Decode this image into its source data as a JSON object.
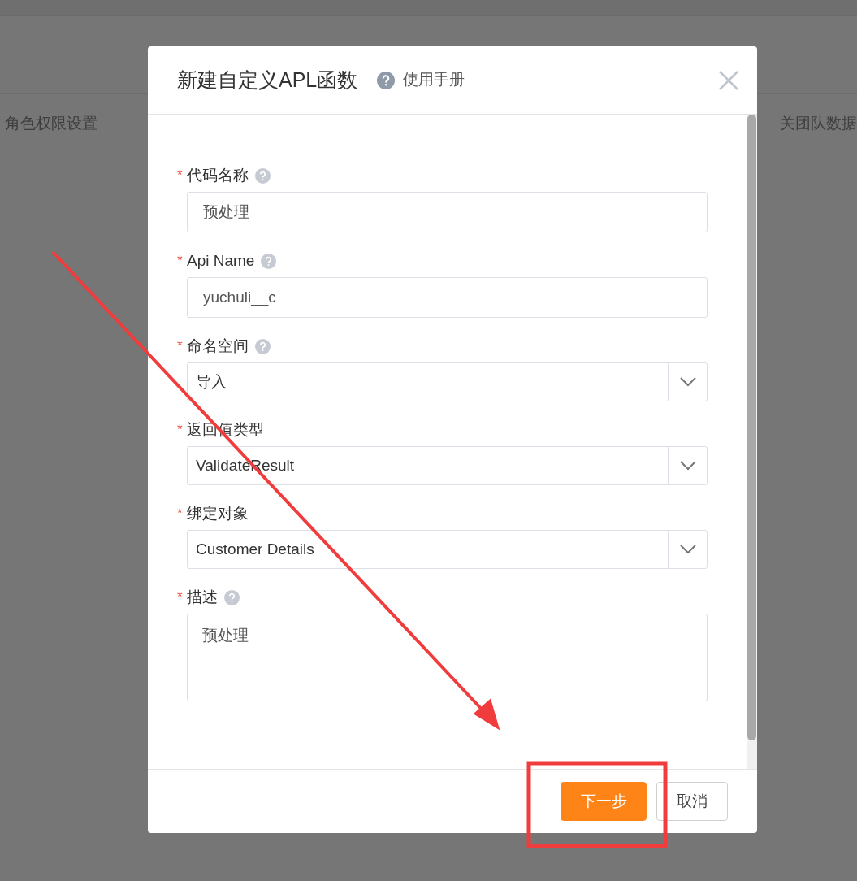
{
  "background_page": {
    "tabs": [
      {
        "label": "角色权限设置"
      },
      {
        "label": "关团队数据"
      }
    ]
  },
  "dialog": {
    "title": "新建自定义APL函数",
    "help_link": "使用手册",
    "fields": [
      {
        "kind": "text",
        "required_mark": "*",
        "label": "代码名称",
        "help": true,
        "value": "预处理"
      },
      {
        "kind": "text",
        "required_mark": "*",
        "label": "Api Name",
        "help": true,
        "value": "yuchuli__c"
      },
      {
        "kind": "select",
        "required_mark": "*",
        "label": "命名空间",
        "help": true,
        "value": "导入"
      },
      {
        "kind": "select",
        "required_mark": "*",
        "label": "返回值类型",
        "value": "ValidateResult"
      },
      {
        "kind": "select",
        "required_mark": "*",
        "label": "绑定对象",
        "value": "Customer Details"
      },
      {
        "kind": "textarea",
        "required_mark": "*",
        "label": "描述",
        "help": true,
        "value": "预处理"
      }
    ],
    "buttons": [
      {
        "kind": "primary",
        "label": "下一步"
      },
      {
        "kind": "default",
        "label": "取消"
      }
    ]
  },
  "annotations": {
    "arrow": true,
    "highlight_box": true
  }
}
